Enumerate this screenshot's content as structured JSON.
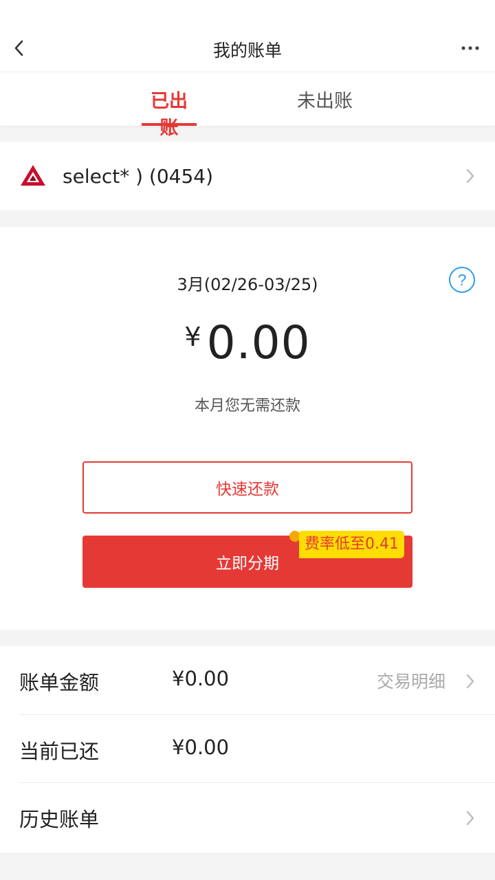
{
  "nav": {
    "title": "我的账单",
    "back_icon": "chevron-left-icon",
    "more_icon": "more-horizontal-icon"
  },
  "tabs": [
    {
      "label": "已出账",
      "active": true
    },
    {
      "label": "未出账",
      "active": false
    }
  ],
  "card": {
    "name": "select* ) (0454)",
    "logo_icon": "bank-logo-icon"
  },
  "bill": {
    "period": "3月(02/26-03/25)",
    "currency": "¥",
    "amount": "0.00",
    "note": "本月您无需还款",
    "quick_repay_label": "快速还款",
    "installment_label": "立即分期",
    "promo_badge": "费率低至0.41"
  },
  "details": [
    {
      "label": "账单金额",
      "value": "¥0.00",
      "link": "交易明细"
    },
    {
      "label": "当前已还",
      "value": "¥0.00"
    },
    {
      "label": "历史账单"
    }
  ],
  "colors": {
    "accent": "#e53935",
    "promo": "#ffdd00",
    "help": "#2e9bf0",
    "background": "#f4f4f4"
  }
}
